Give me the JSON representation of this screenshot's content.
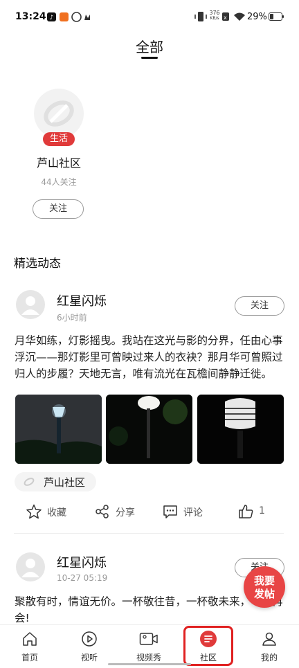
{
  "status_bar": {
    "time": "13:24",
    "speed_top": "376",
    "speed_unit": "KB/s",
    "battery": "29%"
  },
  "header": {
    "title": "全部"
  },
  "community": {
    "tag": "生活",
    "name": "芦山社区",
    "followers": "44人关注",
    "follow_label": "关注"
  },
  "section_title": "精选动态",
  "posts": [
    {
      "user": "红星闪烁",
      "time": "6小时前",
      "follow_label": "关注",
      "text": "月华如练，灯影摇曳。我站在这光与影的分界，任由心事浮沉——那灯影里可曾映过来人的衣袂？那月华可曾照过归人的步履？天地无言，唯有流光在瓦檐间静静迁徙。",
      "community_tag": "芦山社区",
      "actions": {
        "collect": "收藏",
        "share": "分享",
        "comment": "评论",
        "likes": "1"
      }
    },
    {
      "user": "红星闪烁",
      "time": "10-27 05:19",
      "follow_label": "关注",
      "text": "聚散有时，情谊无价。一杯敬往昔，一杯敬未来，一份再会!"
    }
  ],
  "fab": {
    "line1": "我要",
    "line2": "发帖"
  },
  "bottom_nav": [
    {
      "label": "首页",
      "icon": "home-icon"
    },
    {
      "label": "视听",
      "icon": "play-icon"
    },
    {
      "label": "视频秀",
      "icon": "video-camera-icon"
    },
    {
      "label": "社区",
      "icon": "community-icon",
      "active": true
    },
    {
      "label": "我的",
      "icon": "profile-icon"
    }
  ],
  "colors": {
    "accent": "#e03a3a",
    "text": "#222222",
    "muted": "#999999"
  }
}
